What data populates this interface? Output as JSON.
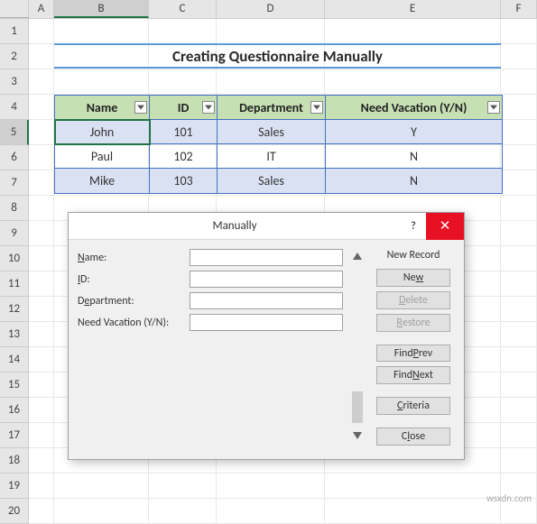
{
  "columns": [
    "A",
    "B",
    "C",
    "D",
    "E",
    "F"
  ],
  "rows": [
    "1",
    "2",
    "3",
    "4",
    "5",
    "6",
    "7",
    "8",
    "9",
    "10",
    "11",
    "12",
    "13",
    "14",
    "15",
    "16",
    "17",
    "18",
    "19",
    "20"
  ],
  "title": "Creating Questionnaire Manually",
  "table": {
    "headers": [
      "Name",
      "ID",
      "Department",
      "Need Vacation (Y/N)"
    ],
    "rows": [
      {
        "name": "John",
        "id": "101",
        "dept": "Sales",
        "vac": "Y"
      },
      {
        "name": "Paul",
        "id": "102",
        "dept": "IT",
        "vac": "N"
      },
      {
        "name": "Mike",
        "id": "103",
        "dept": "Sales",
        "vac": "N"
      }
    ]
  },
  "dialog": {
    "title": "Manually",
    "record_label": "New Record",
    "fields": {
      "name": {
        "label": "Name:",
        "value": ""
      },
      "id": {
        "label": "ID:",
        "value": ""
      },
      "dept": {
        "label": "Department:",
        "value": ""
      },
      "vac": {
        "label": "Need Vacation (Y/N):",
        "value": ""
      }
    },
    "buttons": {
      "new": "New",
      "delete": "Delete",
      "restore": "Restore",
      "find_prev": "Find Prev",
      "find_next": "Find Next",
      "criteria": "Criteria",
      "close": "Close"
    }
  },
  "watermark": "wsxdn.com"
}
